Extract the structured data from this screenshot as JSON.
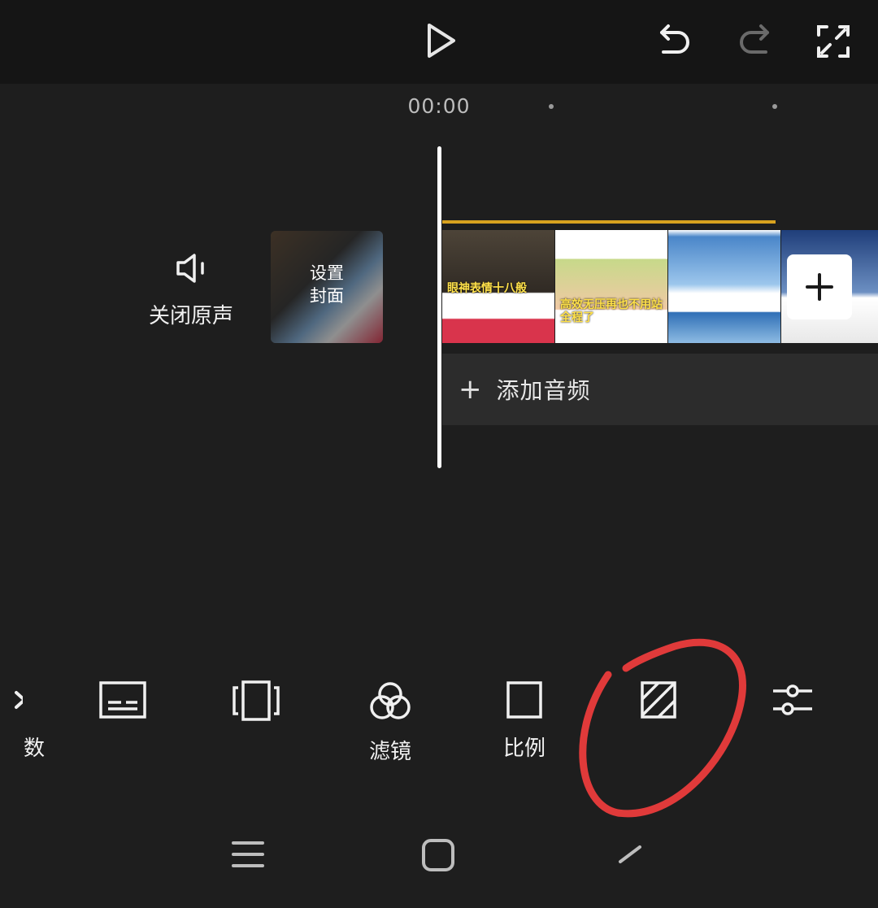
{
  "player": {
    "timestamp": "00:00"
  },
  "icons": {
    "play": "play-icon",
    "undo": "undo-icon",
    "redo": "redo-icon",
    "fullscreen": "fullscreen-icon",
    "mute": "speaker-icon",
    "add_clip": "plus-icon"
  },
  "timeline": {
    "mute_label": "关闭原声",
    "cover_label": "设置\n封面",
    "frames": [
      {
        "caption": "眼神表情十八般"
      },
      {
        "caption": "高效无压再也不用站全程了"
      },
      {
        "caption": ""
      },
      {
        "caption": ""
      }
    ],
    "add_audio_label": "添加音频",
    "add_audio_plus": "+"
  },
  "toolbar": {
    "items": [
      {
        "label": "数",
        "icon": "partial-icon"
      },
      {
        "label": "",
        "icon": "subtitle-icon"
      },
      {
        "label": "",
        "icon": "overlay-icon"
      },
      {
        "label": "滤镜",
        "icon": "filter-icon"
      },
      {
        "label": "比例",
        "icon": "aspect-ratio-icon"
      },
      {
        "label": "",
        "icon": "background-hatch-icon"
      },
      {
        "label": "",
        "icon": "adjust-sliders-icon"
      }
    ]
  },
  "navbar": {
    "icons": [
      "recent-apps-icon",
      "home-icon",
      "back-icon"
    ]
  },
  "colors": {
    "background": "#1e1e1e",
    "topbar": "#151515",
    "track_highlight": "#d8a21f",
    "annotation": "#e03a3a"
  }
}
